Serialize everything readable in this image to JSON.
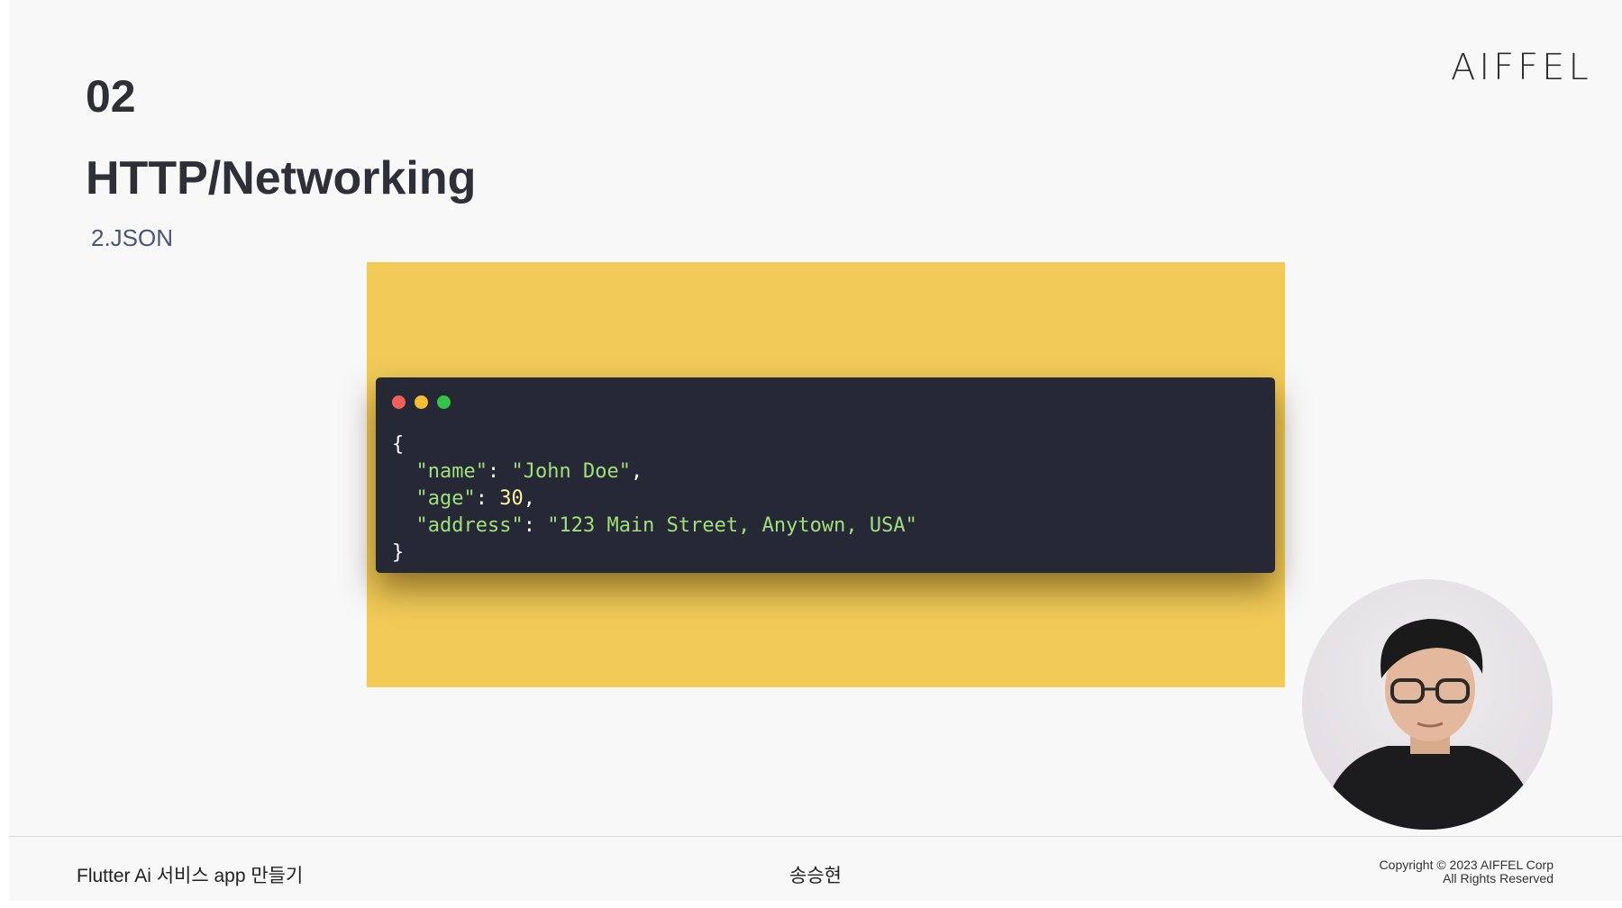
{
  "slide": {
    "section_number": "02",
    "title": "HTTP/Networking",
    "subtitle": "2.JSON",
    "logo": "AIFFEL"
  },
  "code_window": {
    "dots": [
      "red-dot-icon",
      "yellow-dot-icon",
      "green-dot-icon"
    ],
    "lines": {
      "open": "{",
      "name_key": "\"name\"",
      "name_value": "\"John Doe\"",
      "age_key": "\"age\"",
      "age_value": "30",
      "address_key": "\"address\"",
      "address_value": "\"123 Main Street, Anytown, USA\"",
      "close": "}"
    },
    "colors": {
      "panel_background": "#f1ca58",
      "window_background": "#272836",
      "string_color": "#9fe07d",
      "number_color": "#fbf4a0"
    }
  },
  "presenter": {
    "icon": "presenter-webcam-avatar"
  },
  "footer": {
    "course_title": "Flutter Ai 서비스 app 만들기",
    "instructor": "송승현",
    "copyright_line1": "Copyright © 2023 AIFFEL Corp",
    "copyright_line2": "All Rights Reserved"
  }
}
